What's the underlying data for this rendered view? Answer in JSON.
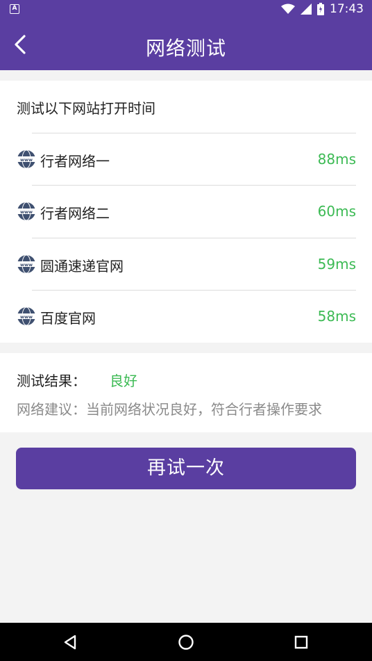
{
  "status_bar": {
    "time": "17:43",
    "left_icon": "A",
    "icons": [
      "wifi-icon",
      "signal-icon",
      "battery-icon"
    ]
  },
  "app_bar": {
    "title": "网络测试",
    "back_icon": "chevron-left-icon"
  },
  "test_list": {
    "header": "测试以下网站打开时间",
    "items": [
      {
        "name": "行者网络一",
        "time": "88ms",
        "icon": "www-globe-icon"
      },
      {
        "name": "行者网络二",
        "time": "60ms",
        "icon": "www-globe-icon"
      },
      {
        "name": "圆通速递官网",
        "time": "59ms",
        "icon": "www-globe-icon"
      },
      {
        "name": "百度官网",
        "time": "58ms",
        "icon": "www-globe-icon"
      }
    ]
  },
  "result": {
    "label": "测试结果：",
    "value": "良好",
    "advice": "网络建议：当前网络状况良好，符合行者操作要求"
  },
  "retry_button": {
    "label": "再试一次"
  },
  "colors": {
    "primary": "#5a3ea1",
    "success": "#3cba54",
    "background": "#f3f3f3"
  },
  "nav_bar": {
    "icons": [
      "back-triangle-icon",
      "home-circle-icon",
      "recents-square-icon"
    ]
  }
}
